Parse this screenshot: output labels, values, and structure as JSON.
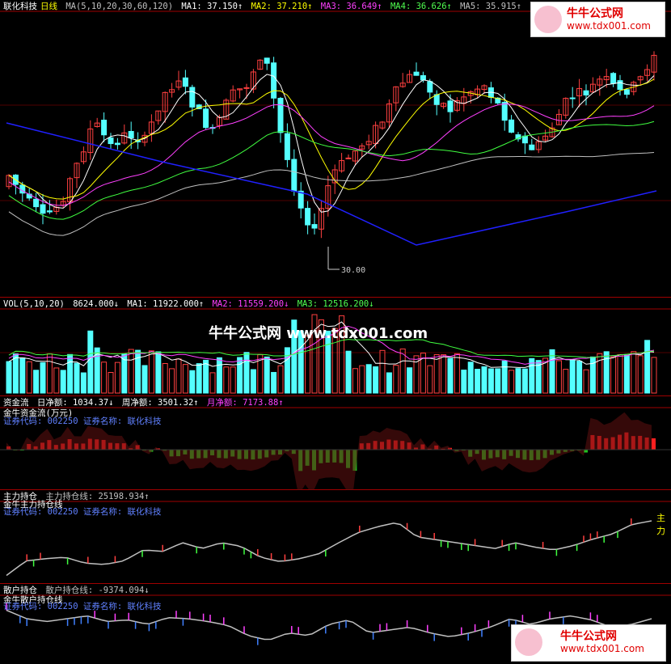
{
  "main": {
    "stock_name": "联化科技",
    "period": "日线",
    "ma_label": "MA(5,10,20,30,60,120)",
    "ma1": "MA1: 37.150↑",
    "ma2": "MA2: 37.210↑",
    "ma3": "MA3: 36.649↑",
    "ma4": "MA4: 36.626↑",
    "ma5": "MA5: 35.915↑",
    "low_marker": "30.00",
    "colors": {
      "up": "#ff4040",
      "down": "#54ffff",
      "ma1": "#ffffff",
      "ma2": "#ffff00",
      "ma3": "#ff40ff",
      "ma4": "#40ff40",
      "ma5": "#c0c0c0",
      "ma6": "#2020ff"
    }
  },
  "volume": {
    "label": "VOL(5,10,20)",
    "value": "8624.000↓",
    "ma1": "MA1: 11922.000↑",
    "ma2": "MA2: 11559.200↓",
    "ma3": "MA3: 12516.200↓"
  },
  "fund_flow": {
    "label": "资金流",
    "daily": "日净额: 1034.37↓",
    "weekly": "周净额: 3501.32↑",
    "monthly": "月净额: 7173.88↑",
    "title": "金牛资金流(万元)",
    "code_line": "证券代码: 002250  证券名称: 联化科技"
  },
  "main_position": {
    "label": "主力持仓",
    "line": "主力持仓线: 25198.934↑",
    "title": "金牛主力持仓线",
    "code_line": "证券代码: 002250  证券名称: 联化科技",
    "tag": "主力"
  },
  "retail_position": {
    "label": "散户持仓",
    "line": "散户持仓线: -9374.094↓",
    "title": "金牛散户持仓线",
    "code_line": "证券代码: 002250  证券名称: 联化科技"
  },
  "watermark": {
    "center_text": "牛牛公式网 www.tdx001.com",
    "logo_title": "牛牛公式网",
    "logo_url": "www.tdx001.com"
  }
}
